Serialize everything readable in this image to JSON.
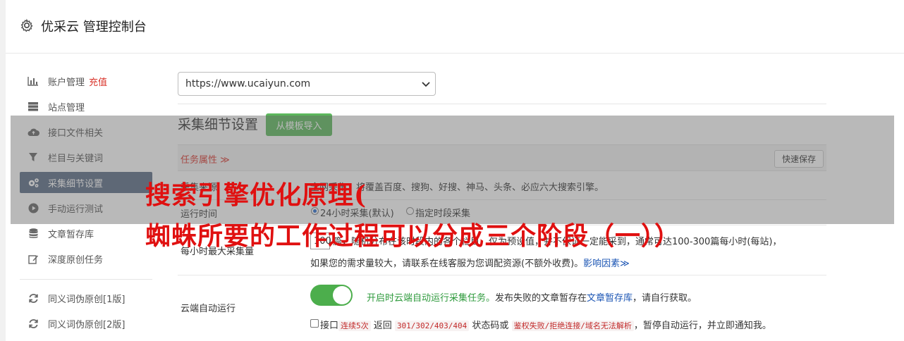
{
  "header": {
    "title": "优采云 管理控制台",
    "icon": "gear-icon"
  },
  "sidebar": {
    "items": [
      {
        "label": "账户管理",
        "extra": "充值",
        "icon": "bar-chart-icon"
      },
      {
        "label": "站点管理",
        "icon": "server-icon"
      },
      {
        "label": "接口文件相关",
        "icon": "cloud-upload-icon"
      },
      {
        "label": "栏目与关键词",
        "icon": "filter-icon"
      },
      {
        "label": "采集细节设置",
        "icon": "cogs-icon",
        "active": true
      },
      {
        "label": "手动运行测试",
        "icon": "play-icon"
      },
      {
        "label": "文章暂存库",
        "icon": "database-icon"
      },
      {
        "label": "深度原创任务",
        "icon": "edit-icon"
      },
      {
        "label": "同义词伪原创[1版]",
        "icon": "refresh-icon"
      },
      {
        "label": "同义词伪原创[2版]",
        "icon": "refresh-icon"
      }
    ]
  },
  "site_select": {
    "value": "https://www.ucaiyun.com"
  },
  "section": {
    "title": "采集细节设置",
    "import_button": "从模板导入"
  },
  "task_bar": {
    "label": "任务属性 ≫",
    "save_button": "快速保存"
  },
  "rows": {
    "search_engine": {
      "label": "采集来源",
      "text": "全网采集：将覆盖百度、搜狗、好搜、神马、头条、必应六大搜索引擎。"
    },
    "run_time": {
      "label": "运行时间",
      "option_24h": "24小时采集(默认)",
      "option_period": "指定时段采集"
    },
    "max_per_hour": {
      "label": "每小时最大采集量",
      "value": "100",
      "text1": "篇，随机分布在该时段内的各个栏目，仅为预设值，并不保证一定能采到，通常可达100-300篇每小时(每站)，",
      "text2": "如果您的需求量较大，请联系在线客服为您调配资源(不额外收费)。",
      "link": "影响因素≫"
    },
    "cloud_run": {
      "label": "云端自动运行",
      "enabled_text": "开启时云端自动运行采集任务。",
      "text_a": "发布失败的文章暂存在",
      "link": "文章暂存库",
      "text_b": "，请自行获取。",
      "chk_a": "接口",
      "code1": "连续5次",
      "chk_b": "返回",
      "code2": "301/302/403/404",
      "chk_c": "状态码或",
      "code3": "鉴权失败/拒绝连接/域名无法解析",
      "chk_d": "，暂停自动运行，并立即通知我。"
    }
  },
  "watermark": {
    "line1": "搜索引擎优化原理(",
    "line2": "蜘蛛所要的工作过程可以分成三个阶段（一））"
  },
  "colors": {
    "accent_red": "#d9342b",
    "active_bg": "#5a6c85",
    "green": "#5cb85c",
    "watermark": "#e01010"
  }
}
